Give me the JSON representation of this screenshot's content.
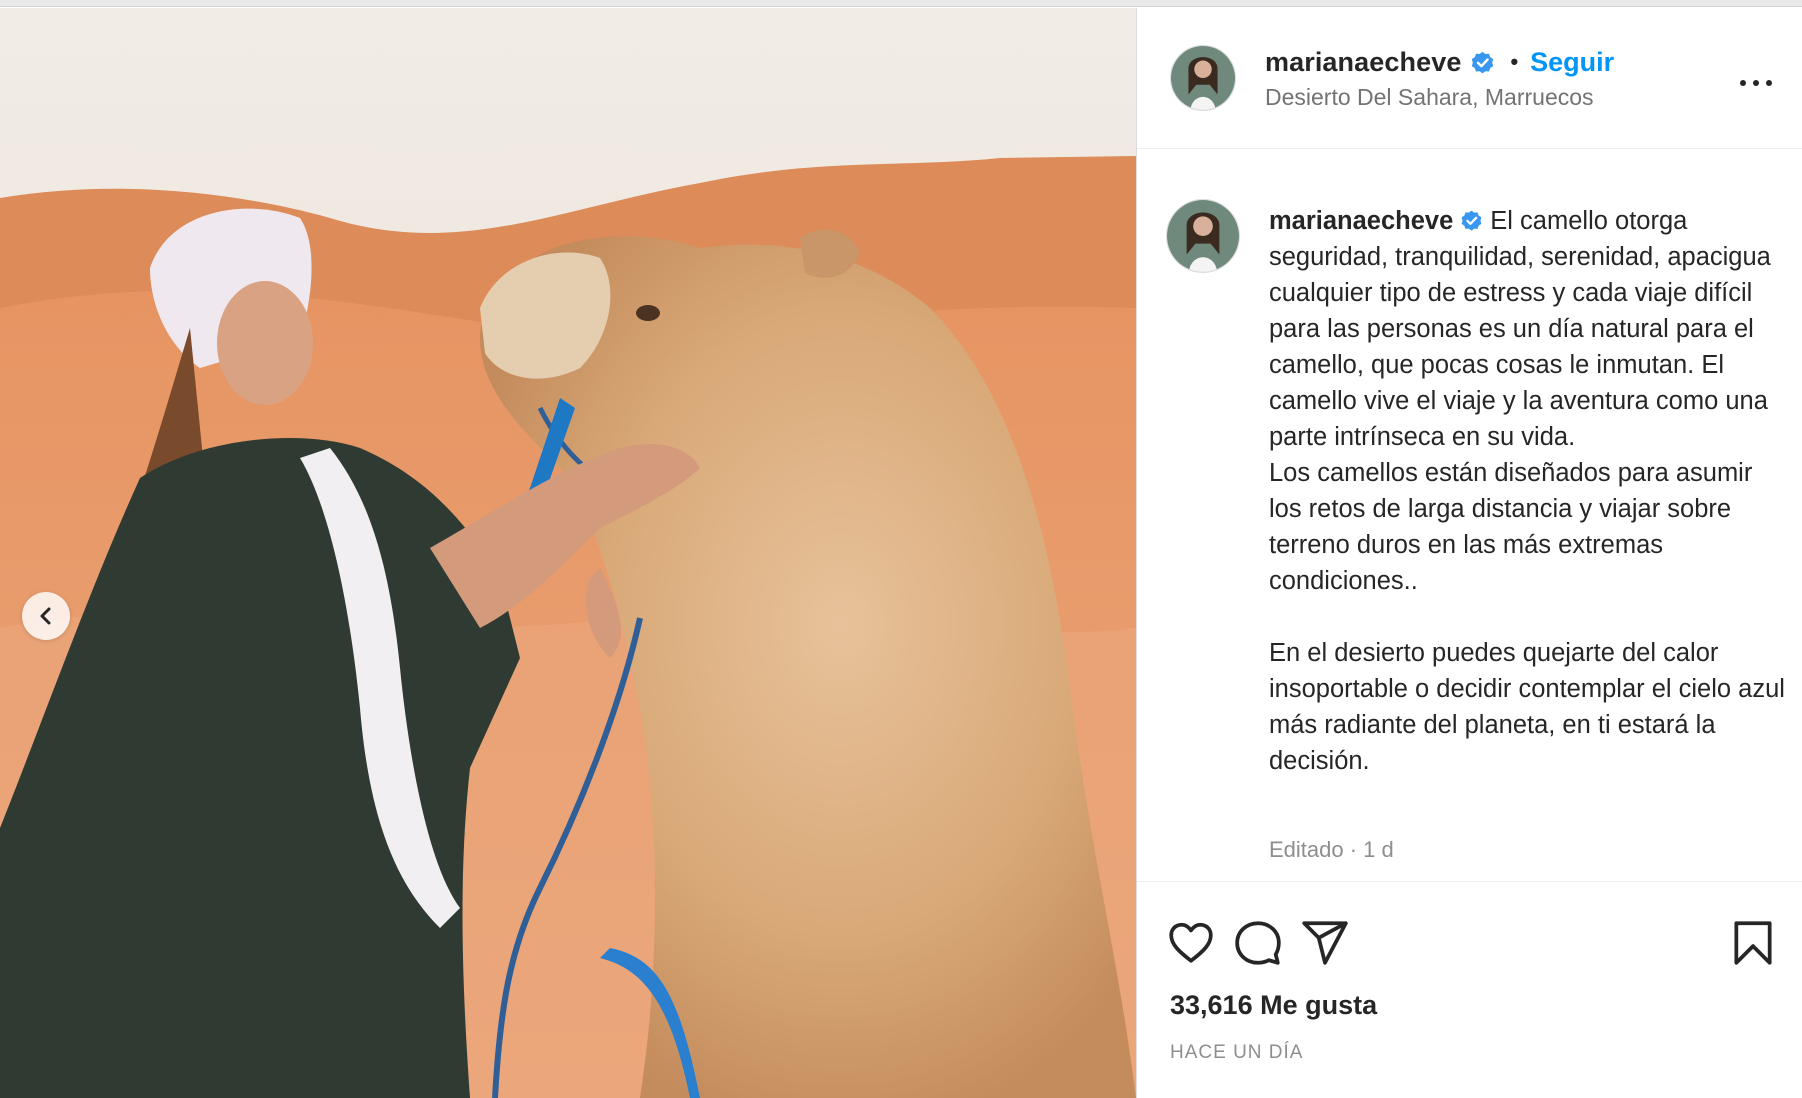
{
  "post": {
    "username": "marianaecheve",
    "separator": "•",
    "follow_label": "Seguir",
    "location": "Desierto Del Sahara, Marruecos",
    "verified": true
  },
  "caption": {
    "username": "marianaecheve",
    "text": "El camello otorga seguridad, tranquilidad, serenidad, apacigua cualquier tipo de estress y cada viaje difícil para las personas es un día natural para el camello, que pocas cosas le inmutan. El camello vive el viaje y la aventura como una parte intrínseca en su vida.\nLos camellos están diseñados para asumir los retos de larga distancia y viajar sobre terreno duros en las más extremas condiciones..\n\nEn el desierto puedes quejarte del calor insoportable o decidir contemplar el cielo azul más radiante del planeta, en ti estará la decisión.",
    "edited_label": "Editado · 1 d"
  },
  "stats": {
    "likes": "33,616 Me gusta",
    "timestamp": "HACE UN DÍA"
  },
  "icons": {
    "like": "heart-icon",
    "comment": "comment-icon",
    "share": "paper-plane-icon",
    "save": "bookmark-icon",
    "more": "more-options-icon",
    "carousel_prev": "chevron-left-icon",
    "verified": "verified-badge-icon"
  },
  "colors": {
    "accent": "#0095f6",
    "verified": "#3897f0",
    "text": "#262626",
    "muted": "#737373"
  }
}
